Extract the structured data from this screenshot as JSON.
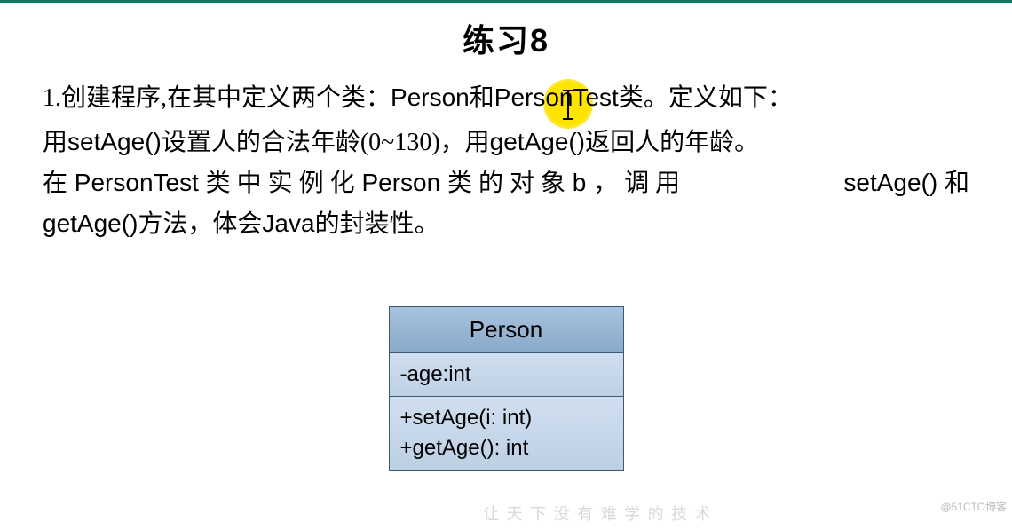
{
  "title": "练习8",
  "para1_pre": "1.创建程序,在其中定义两个类：",
  "para1_w1": "Perso",
  "para1_w1b": "n",
  "para1_mid": "和",
  "para1_w2": "PersonTest",
  "para1_post": "类。定义如下：",
  "p2_l1_a": "用",
  "p2_l1_b": "setAge()",
  "p2_l1_c": "设置人的合法年龄(0~130)，用",
  "p2_l1_d": "getAge()",
  "p2_l1_e": "返回人的年龄。",
  "p2_l2_a": "在",
  "p2_l2_b": " PersonTest ",
  "p2_l2_c": "类 中 实 例 化",
  "p2_l2_d": " Person ",
  "p2_l2_e": "类 的 对 象",
  "p2_l2_f": " b ",
  "p2_l2_g": "， 调 用",
  "p2_l2_h": " setAge() ",
  "p2_l2_i": "和",
  "p2_l3_a": "getAge()",
  "p2_l3_b": "方法，体会",
  "p2_l3_c": "Java",
  "p2_l3_d": "的封装性。",
  "uml": {
    "name": "Person",
    "attr": "-age:int",
    "op1": "+setAge(i: int)",
    "op2": "+getAge(): int"
  },
  "watermark_right": "@51CTO博客",
  "watermark_center": "让 天 下 没 有 难 学 的 技 术"
}
